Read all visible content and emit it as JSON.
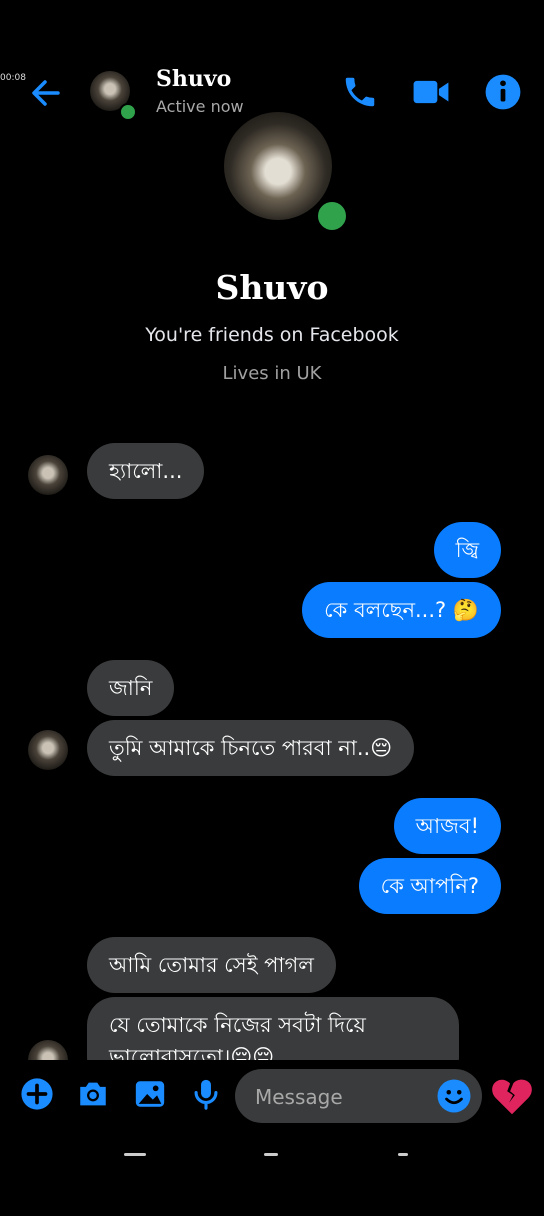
{
  "status": {
    "timer": "00:08"
  },
  "header": {
    "name": "Shuvo",
    "status": "Active now"
  },
  "profile": {
    "name": "Shuvo",
    "friends_text": "You're friends on Facebook",
    "lives_text": "Lives in UK"
  },
  "messages": [
    {
      "side": "in",
      "text": "হ্যালো..."
    },
    {
      "side": "out",
      "text": "জ্বি"
    },
    {
      "side": "out",
      "text": "কে বলছেন...? 🤔"
    },
    {
      "side": "in",
      "text": "জানি"
    },
    {
      "side": "in",
      "text": "তুমি আমাকে চিনতে পারবা না..😔"
    },
    {
      "side": "out",
      "text": "আজব!"
    },
    {
      "side": "out",
      "text": "কে আপনি?"
    },
    {
      "side": "in",
      "text": "আমি তোমার সেই পাগল"
    },
    {
      "side": "in",
      "text": "যে তোমাকে নিজের সবটা দিয়ে ভালোবাসতো।😔😔"
    }
  ],
  "composer": {
    "placeholder": "Message"
  },
  "colors": {
    "accent": "#0a7cff",
    "incoming_bubble": "#3a3b3c",
    "online": "#31a24c",
    "broken_heart": "#e0245e"
  }
}
